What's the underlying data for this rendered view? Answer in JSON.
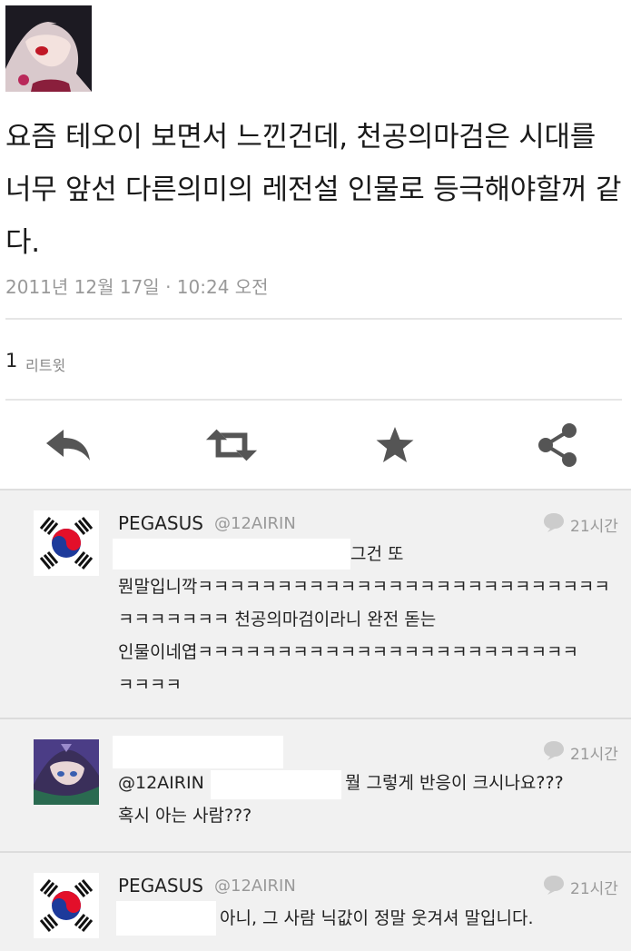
{
  "tweet": {
    "text": "요즘 테오이 보면서 느낀건데, 천공의마검은 시대를 너무 앞선 다른의미의 레전설 인물로 등극해야할꺼 같다.",
    "timestamp": "2011년 12월 17일 · 10:24 오전",
    "retweet_count": "1",
    "retweet_label": "리트윗"
  },
  "actions": [
    {
      "icon": "reply-icon"
    },
    {
      "icon": "retweet-icon"
    },
    {
      "icon": "favorite-star-icon"
    },
    {
      "icon": "share-icon"
    }
  ],
  "replies": [
    {
      "name": "PEGASUS",
      "handle": "@12AIRIN",
      "time": "21시간",
      "line1_suffix": "그건 또",
      "line2": "뭔말입니깍ㅋㅋㅋㅋㅋㅋㅋㅋㅋㅋㅋㅋㅋㅋㅋㅋㅋㅋㅋㅋㅋㅋㅋㅋㅋㅋ",
      "line3": "ㅋㅋㅋㅋㅋㅋㅋ 천공의마검이라니 완전 돋는",
      "line4": "인물이네엽ㅋㅋㅋㅋㅋㅋㅋㅋㅋㅋㅋㅋㅋㅋㅋㅋㅋㅋㅋㅋㅋㅋㅋㅋ",
      "line5": "ㅋㅋㅋㅋ"
    },
    {
      "time": "21시간",
      "line1_prefix": "@12AIRIN",
      "line1_suffix": "뭘 그렇게 반응이 크시나요???",
      "line2": "혹시 아는 사람???"
    },
    {
      "name": "PEGASUS",
      "handle": "@12AIRIN",
      "time": "21시간",
      "line1_suffix": "아니, 그 사람 닉값이 정말 웃겨셔 말입니다."
    }
  ],
  "colors": {
    "flag_red": "#e30f2a",
    "flag_blue": "#1d3a9b",
    "icon_gray": "#555555"
  }
}
